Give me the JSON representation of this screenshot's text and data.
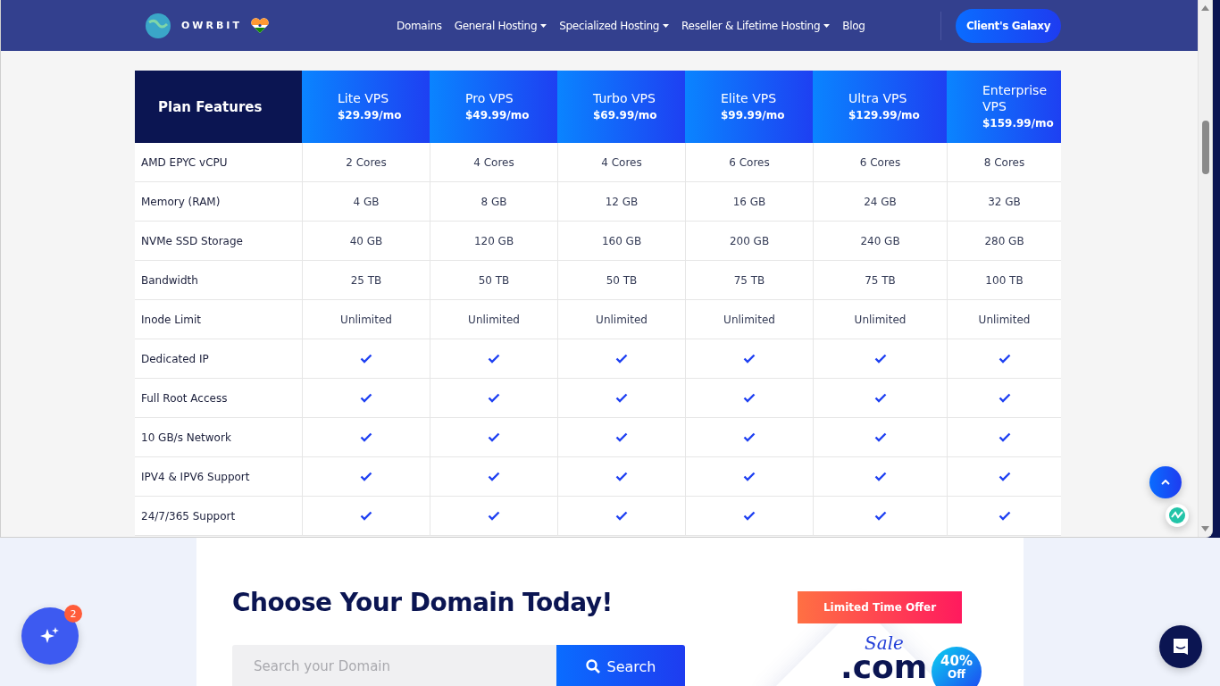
{
  "header": {
    "brand": "OWRBIT",
    "nav": [
      {
        "label": "Domains",
        "dropdown": false
      },
      {
        "label": "General Hosting",
        "dropdown": true
      },
      {
        "label": "Specialized Hosting",
        "dropdown": true
      },
      {
        "label": "Reseller & Lifetime Hosting",
        "dropdown": true
      },
      {
        "label": "Blog",
        "dropdown": false
      }
    ],
    "cta": "Client's Galaxy"
  },
  "table": {
    "corner": "Plan Features",
    "plans": [
      {
        "name": "Lite VPS",
        "price": "$29.99/mo"
      },
      {
        "name": "Pro VPS",
        "price": "$49.99/mo"
      },
      {
        "name": "Turbo VPS",
        "price": "$69.99/mo"
      },
      {
        "name": "Elite VPS",
        "price": "$99.99/mo"
      },
      {
        "name": "Ultra VPS",
        "price": "$129.99/mo"
      },
      {
        "name": "Enterprise VPS",
        "price": "$159.99/mo"
      }
    ],
    "rows": [
      {
        "feature": "AMD EPYC vCPU",
        "kind": "text",
        "values": [
          "2 Cores",
          "4 Cores",
          "4 Cores",
          "6 Cores",
          "6 Cores",
          "8 Cores"
        ]
      },
      {
        "feature": "Memory (RAM)",
        "kind": "text",
        "values": [
          "4 GB",
          "8 GB",
          "12 GB",
          "16 GB",
          "24 GB",
          "32 GB"
        ]
      },
      {
        "feature": "NVMe SSD Storage",
        "kind": "text",
        "values": [
          "40 GB",
          "120 GB",
          "160 GB",
          "200 GB",
          "240 GB",
          "280 GB"
        ]
      },
      {
        "feature": "Bandwidth",
        "kind": "text",
        "values": [
          "25 TB",
          "50 TB",
          "50 TB",
          "75 TB",
          "75 TB",
          "100 TB"
        ]
      },
      {
        "feature": "Inode Limit",
        "kind": "text",
        "values": [
          "Unlimited",
          "Unlimited",
          "Unlimited",
          "Unlimited",
          "Unlimited",
          "Unlimited"
        ]
      },
      {
        "feature": "Dedicated IP",
        "kind": "check",
        "checks": [
          true,
          true,
          true,
          true,
          true,
          true
        ]
      },
      {
        "feature": "Full Root Access",
        "kind": "check",
        "checks": [
          true,
          true,
          true,
          true,
          true,
          true
        ]
      },
      {
        "feature": "10 GB/s Network",
        "kind": "check",
        "checks": [
          true,
          true,
          true,
          true,
          true,
          true
        ]
      },
      {
        "feature": "IPV4 & IPV6 Support",
        "kind": "check",
        "checks": [
          true,
          true,
          true,
          true,
          true,
          true
        ]
      },
      {
        "feature": "24/7/365 Support",
        "kind": "check",
        "checks": [
          true,
          true,
          true,
          true,
          true,
          true
        ]
      }
    ]
  },
  "domain": {
    "title": "Choose Your Domain Today!",
    "placeholder": "Search your Domain",
    "button": "Search",
    "promo": {
      "ribbon": "Limited Time Offer",
      "script": "Sale",
      "tld": ".com",
      "discount": "40%",
      "discount_sub": "Off"
    }
  },
  "assistant_badge": "2"
}
